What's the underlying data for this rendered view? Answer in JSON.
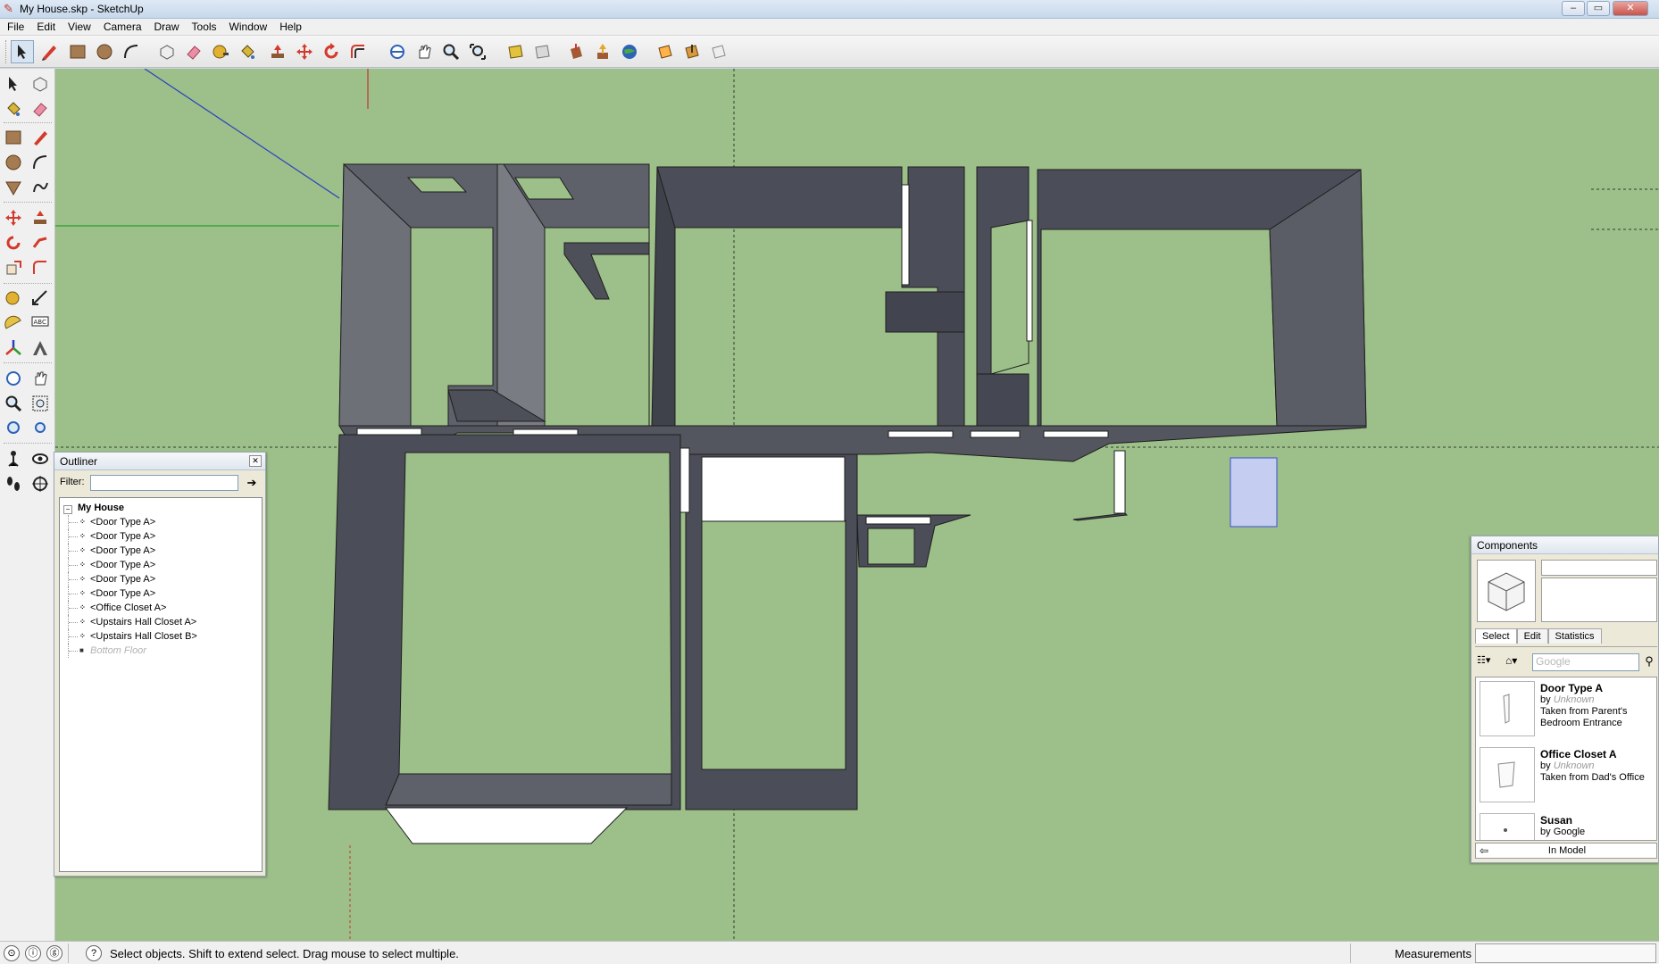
{
  "window": {
    "title": "My House.skp - SketchUp",
    "controls": [
      "minimize",
      "maximize",
      "close"
    ]
  },
  "menubar": {
    "items": [
      "File",
      "Edit",
      "View",
      "Camera",
      "Draw",
      "Tools",
      "Window",
      "Help"
    ]
  },
  "toolbar": {
    "tools": [
      "select-icon",
      "pencil-line-icon",
      "rectangle-icon",
      "circle-icon",
      "arc-icon",
      "make-component-icon",
      "eraser-icon",
      "tape-measure-icon",
      "paint-bucket-icon",
      "push-pull-icon",
      "move-icon",
      "rotate-icon",
      "offset-icon",
      "orbit-icon",
      "pan-icon",
      "zoom-icon",
      "zoom-extents-icon",
      "previous-view-icon",
      "next-view-icon",
      "get-models-icon",
      "share-model-icon",
      "share-component-icon",
      "google-earth-icon",
      "section-plane-icon",
      "section-fill-icon",
      "section-display-icon"
    ]
  },
  "left_toolbar": {
    "tools": [
      "select-icon",
      "make-component-icon",
      "paint-bucket-icon",
      "eraser-icon",
      "rectangle-icon",
      "line-icon",
      "circle-icon",
      "arc-icon",
      "polygon-icon",
      "freehand-icon",
      "move-icon",
      "push-pull-icon",
      "rotate-icon",
      "follow-me-icon",
      "scale-icon",
      "offset-icon",
      "tape-measure-icon",
      "dimension-icon",
      "protractor-icon",
      "text-icon",
      "axes-icon",
      "3d-text-icon",
      "orbit-icon",
      "pan-icon",
      "zoom-icon",
      "zoom-window-icon",
      "previous-icon",
      "zoom-extents-icon",
      "position-camera-icon",
      "look-around-icon",
      "walk-icon",
      "section-plane-icon"
    ]
  },
  "outliner": {
    "title": "Outliner",
    "filter_label": "Filter:",
    "filter_value": "",
    "root": "My House",
    "items": [
      {
        "label": "<Door Type A>",
        "hidden": false
      },
      {
        "label": "<Door Type A>",
        "hidden": false
      },
      {
        "label": "<Door Type A>",
        "hidden": false
      },
      {
        "label": "<Door Type A>",
        "hidden": false
      },
      {
        "label": "<Door Type A>",
        "hidden": false
      },
      {
        "label": "<Door Type A>",
        "hidden": false
      },
      {
        "label": "<Office Closet A>",
        "hidden": false
      },
      {
        "label": "<Upstairs Hall Closet A>",
        "hidden": false
      },
      {
        "label": "<Upstairs Hall Closet B>",
        "hidden": false
      },
      {
        "label": "Bottom Floor",
        "hidden": true
      }
    ]
  },
  "components": {
    "title": "Components",
    "tabs": [
      "Select",
      "Edit",
      "Statistics"
    ],
    "active_tab": "Select",
    "search_placeholder": "Google",
    "items": [
      {
        "name": "Door Type A",
        "by_label": "by",
        "author": "Unknown",
        "description": "Taken from Parent's Bedroom Entrance"
      },
      {
        "name": "Office Closet A",
        "by_label": "by",
        "author": "Unknown",
        "description": "Taken from Dad's Office"
      },
      {
        "name": "Susan",
        "by_label": "by",
        "author": "Google",
        "description": ""
      }
    ],
    "footer": "In Model"
  },
  "statusbar": {
    "hint": "Select objects. Shift to extend select. Drag mouse to select multiple.",
    "measurements_label": "Measurements",
    "measurements_value": ""
  },
  "colors": {
    "ground": "#9dbf8a",
    "wall_dark": "#4b4e58",
    "wall_mid": "#5c5f68",
    "wall_light": "#6e7078",
    "selection_blue": "#c5cdf0",
    "axis_red": "#c0392b",
    "axis_green": "#2e9c2e",
    "axis_blue": "#2a3fbf"
  }
}
